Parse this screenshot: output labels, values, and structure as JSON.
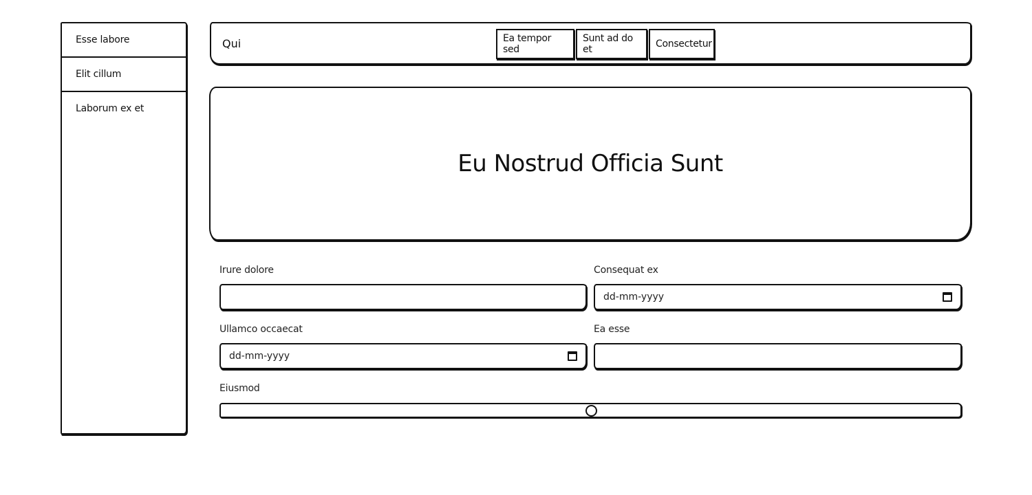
{
  "sidebar": {
    "items": [
      {
        "label": "Esse labore"
      },
      {
        "label": "Elit cillum"
      },
      {
        "label": "Laborum ex et"
      }
    ]
  },
  "header": {
    "brand": "Qui",
    "nav": [
      {
        "label": "Ea tempor sed"
      },
      {
        "label": "Sunt ad do et"
      },
      {
        "label": "Consectetur"
      }
    ]
  },
  "hero": {
    "title": "Eu Nostrud Officia Sunt"
  },
  "form": {
    "field1": {
      "label": "Irure dolore",
      "value": ""
    },
    "field2": {
      "label": "Consequat ex",
      "value": "dd-mm-yyyy"
    },
    "field3": {
      "label": "Ullamco occaecat",
      "value": "dd-mm-yyyy"
    },
    "field4": {
      "label": "Ea esse",
      "value": ""
    },
    "slider": {
      "label": "Eiusmod",
      "value": 50,
      "min": 0,
      "max": 100
    }
  }
}
